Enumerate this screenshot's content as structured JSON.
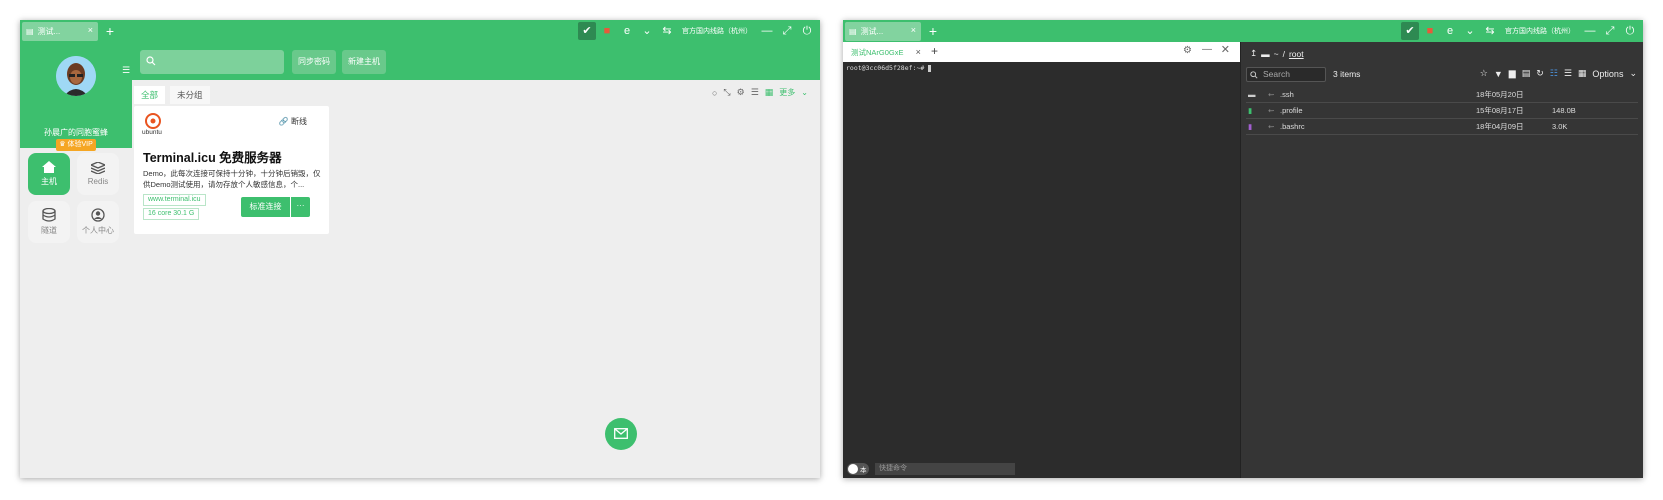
{
  "left_window": {
    "tab_label": "测试...",
    "route_label": "官方国内线路（杭州）",
    "user": {
      "name": "孙晨广的同胞蜜蜂",
      "vip_label": "体验VIP"
    },
    "nav": [
      {
        "label": "主机",
        "active": true
      },
      {
        "label": "Redis",
        "active": false
      },
      {
        "label": "隧道",
        "active": false
      },
      {
        "label": "个人中心",
        "active": false
      }
    ],
    "actions": {
      "sync_label": "同步密码",
      "new_host_label": "新建主机"
    },
    "filter_tabs": [
      "全部",
      "未分组"
    ],
    "more_label": "更多",
    "card": {
      "os_label": "ubuntu",
      "status_label": "断线",
      "title": "Terminal.icu 免费服务器",
      "desc": "Demo，此每次连接可保持十分钟，十分钟后销毁，仅供Demo测试使用，请勿存放个人敏感信息，个...",
      "url": "www.terminal.icu",
      "spec": "16 core 30.1 G",
      "connect_label": "标准连接",
      "more_label": "···"
    }
  },
  "right_window": {
    "tab_label": "测试...",
    "route_label": "官方国内线路（杭州）",
    "term_tab_label": "测试NArG0GxE",
    "prompt": "root@3cc06d5f28ef:~#",
    "quick_toggle_label": "本",
    "quick_placeholder": "快捷命令",
    "fm": {
      "path_home": "~",
      "path_sep": "/",
      "path_current": "root",
      "search_placeholder": "Search",
      "item_count": "3 items",
      "options_label": "Options",
      "files": [
        {
          "name": ".ssh",
          "type": "folder",
          "date": "18年05月20日",
          "size": ""
        },
        {
          "name": ".profile",
          "type": "file",
          "date": "15年08月17日",
          "size": "148.0B"
        },
        {
          "name": ".bashrc",
          "type": "file-purple",
          "date": "18年04月09日",
          "size": "3.0K"
        }
      ]
    }
  },
  "colors": {
    "accent": "#3dbf6e",
    "dark_panel": "#2c2c2c"
  }
}
